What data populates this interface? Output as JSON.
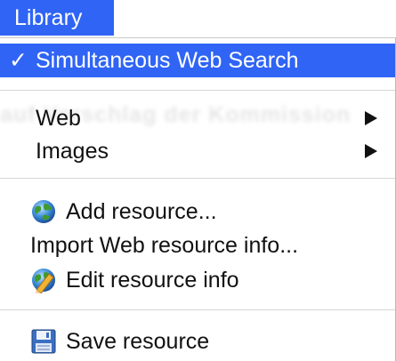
{
  "menubar": {
    "title": "Library"
  },
  "menu": {
    "selected_check": "✓",
    "ghost_text": "auf Vorschlag der Kommission",
    "items": [
      {
        "label": "Simultaneous Web Search",
        "icon": "checkmark"
      },
      {
        "label": "Web",
        "icon": "submenu-arrow"
      },
      {
        "label": "Images",
        "icon": "submenu-arrow"
      },
      {
        "label": "Add resource...",
        "icon": "globe-icon"
      },
      {
        "label": "Import Web resource info...",
        "icon": ""
      },
      {
        "label": "Edit resource info",
        "icon": "globe-pencil-icon"
      },
      {
        "label": "Save resource",
        "icon": "floppy-disk-icon"
      }
    ]
  },
  "colors": {
    "accent": "#2f64f5",
    "text": "#111111",
    "separator": "#d6d6d6"
  }
}
